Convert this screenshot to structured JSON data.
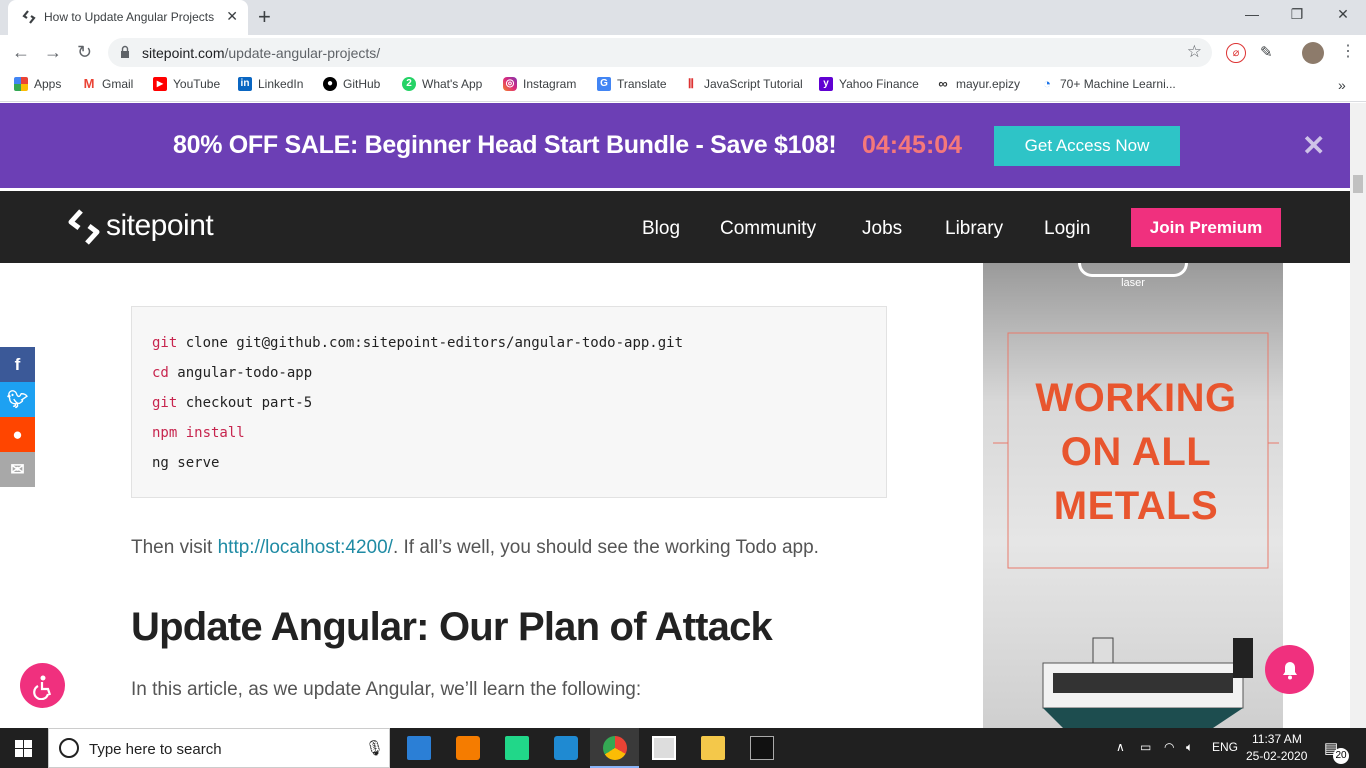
{
  "browser": {
    "tab_title": "How to Update Angular Projects",
    "url_domain": "sitepoint.com",
    "url_path": "/update-angular-projects/",
    "bookmarks": [
      "Apps",
      "Gmail",
      "YouTube",
      "LinkedIn",
      "GitHub",
      "What's App",
      "Instagram",
      "Translate",
      "JavaScript Tutorial",
      "Yahoo Finance",
      "mayur.epizy",
      "70+ Machine Learni..."
    ]
  },
  "promo": {
    "text": "80% OFF SALE: Beginner Head Start Bundle - Save $108!",
    "timer": "04:45:04",
    "cta": "Get Access Now"
  },
  "site": {
    "logo": "sitepoint",
    "nav": [
      "Blog",
      "Community",
      "Jobs",
      "Library",
      "Login"
    ],
    "join": "Join Premium"
  },
  "article": {
    "code": [
      {
        "kw": "git",
        "rest": " clone git@github.com:sitepoint-editors/angular-todo-app.git"
      },
      {
        "kw": "cd",
        "rest": " angular-todo-app"
      },
      {
        "kw": "git",
        "rest": " checkout part-5"
      },
      {
        "kw": "npm install",
        "rest": ""
      },
      {
        "kw": "",
        "rest": "ng serve"
      }
    ],
    "visit_before": "Then visit ",
    "visit_link": "http://localhost:4200/",
    "visit_after": ". If all’s well, you should see the working Todo app.",
    "heading": "Update Angular: Our Plan of Attack",
    "intro": "In this article, as we update Angular, we’ll learn the following:"
  },
  "ad": {
    "brand": "laser",
    "headline_lines": [
      "WORKING",
      "ON ALL",
      "METALS"
    ]
  },
  "taskbar": {
    "search_placeholder": "Type here to search",
    "lang": "ENG",
    "time": "11:37 AM",
    "date": "25-02-2020",
    "notifications": "20"
  },
  "colors": {
    "promo_bg": "#6c3fb5",
    "timer": "#f5787a",
    "cta": "#2ec4c7",
    "pink": "#f0307e",
    "nav_bg": "#232323",
    "link": "#1f8ba4",
    "ad_headline": "#e8552e"
  }
}
